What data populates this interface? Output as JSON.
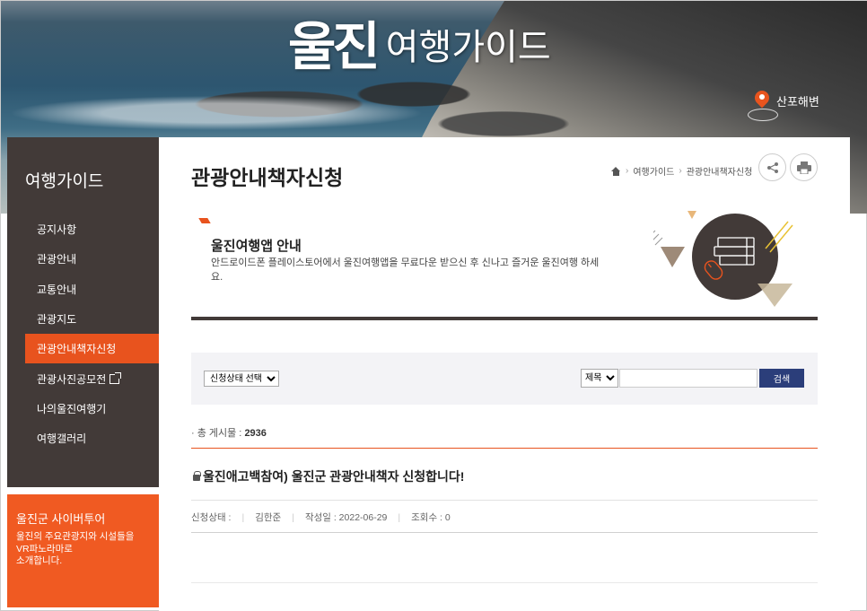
{
  "hero": {
    "logo": "울진",
    "subtitle": "여행가이드",
    "location_label": "산포해변"
  },
  "sidebar": {
    "title": "여행가이드",
    "items": [
      {
        "label": "공지사항"
      },
      {
        "label": "관광안내"
      },
      {
        "label": "교통안내"
      },
      {
        "label": "관광지도"
      },
      {
        "label": "관광안내책자신청",
        "active": true
      },
      {
        "label": "관광사진공모전",
        "external": true
      },
      {
        "label": "나의울진여행기"
      },
      {
        "label": "여행갤러리"
      }
    ]
  },
  "cyber_tour": {
    "title": "울진군 사이버투어",
    "description_lines": [
      "울진의 주요관광지와 시설들을",
      "VR파노라마로",
      "소개합니다."
    ]
  },
  "page": {
    "title": "관광안내책자신청",
    "breadcrumb": [
      "여행가이드",
      "관광안내책자신청"
    ],
    "share_icon": "share-icon",
    "print_icon": "print-icon"
  },
  "banner": {
    "title": "울진여행앱 안내",
    "description": "안드로이드폰 플레이스토어에서 울진여행앱을 무료다운 받으신 후 신나고 즐거운 울진여행 하세요."
  },
  "filter": {
    "status_select": "신청상태 선택",
    "field_select": "제목",
    "search_value": "",
    "search_button": "검색"
  },
  "list": {
    "total_label": "· 총 게시물 :",
    "total_count": "2936"
  },
  "post": {
    "title": "울진애고백참여) 울진군 관광안내책자 신청합니다!",
    "status_label": "신청상태 :",
    "author": "김한준",
    "date_label": "작성일 : 2022-06-29",
    "views_label": "조회수 : 0"
  },
  "colors": {
    "accent": "#e8531e",
    "sidebar": "#423a38",
    "search_button": "#2b3e7a"
  }
}
